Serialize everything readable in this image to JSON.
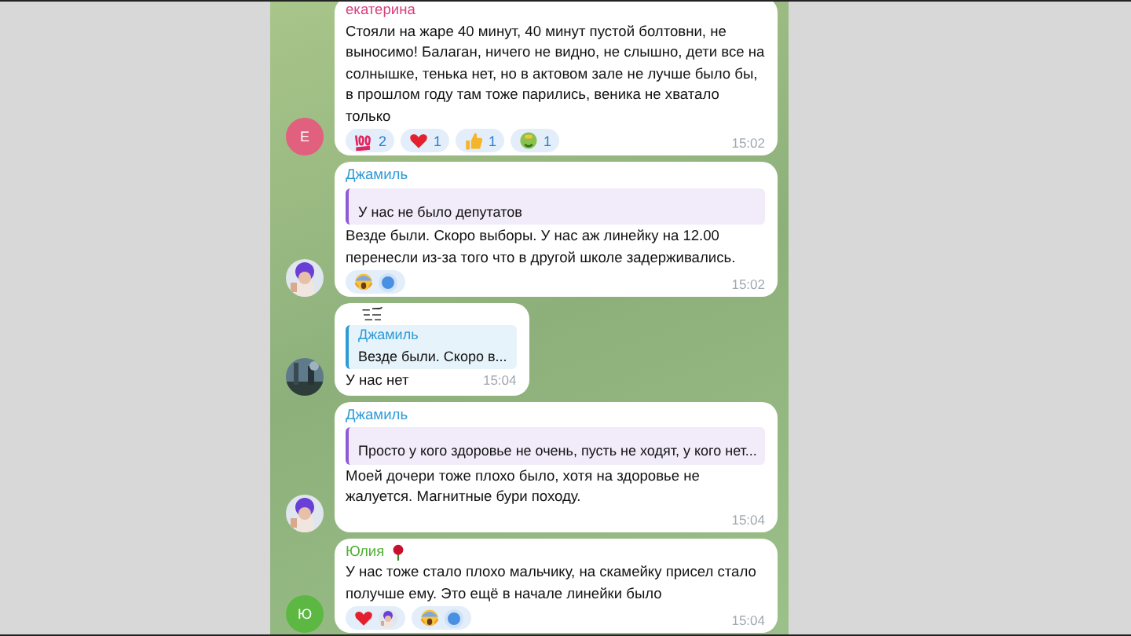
{
  "messages": [
    {
      "sender": "екатерина",
      "color": "#d63f7c",
      "avatar": {
        "kind": "letter",
        "letter": "Е",
        "color": "#e0607e"
      },
      "text": "Стояли на жаре 40 минут, 40 минут пустой болтовни, не выносимо! Балаган, ничего не видно, не слышно, дети все на солнышке, тенька нет, но в актовом зале не лучше было бы, в прошлом году там тоже парились, веника не хватало только",
      "reactions": [
        {
          "kind": "hundred",
          "count": "2"
        },
        {
          "kind": "heart",
          "count": "1"
        },
        {
          "kind": "thumbs-up",
          "count": "1"
        },
        {
          "kind": "sick",
          "count": "1"
        }
      ],
      "time": "15:02"
    },
    {
      "sender": "Джамиль",
      "color": "#2e9ad6",
      "avatar": {
        "kind": "picture"
      },
      "quote": {
        "text": "У нас не было депутатов",
        "color": "#8e5bd6"
      },
      "text": "Везде были. Скоро выборы. У нас аж линейку на 12.00 перенесли из-за того что в другой школе задерживались.",
      "reactions": [
        {
          "kind": "scream",
          "reactor": {
            "kind": "dot",
            "color": "#4a90e2"
          }
        }
      ],
      "time": "15:02"
    },
    {
      "sticker": true,
      "avatar": {
        "kind": "picture"
      },
      "quote": {
        "author": "Джамиль",
        "text": "Везде были. Скоро в...",
        "color": "#2e9ad6"
      },
      "text": "У нас нет",
      "time": "15:04"
    },
    {
      "sender": "Джамиль",
      "color": "#2e9ad6",
      "avatar": {
        "kind": "picture"
      },
      "quote": {
        "text": "Просто у кого здоровье не очень, пусть не ходят, у кого нет...",
        "color": "#8e5bd6"
      },
      "text": "Моей дочери тоже плохо было, хотя на здоровье не жалуется. Магнитные бури походу.",
      "time": "15:04"
    },
    {
      "sender": "Юлия",
      "sender_badge": true,
      "color": "#4fae33",
      "avatar": {
        "kind": "letter",
        "letter": "Ю",
        "color": "#5cb842"
      },
      "text": "У нас тоже стало плохо мальчику, на скамейку присел стало получше ему. Это ещё в начале линейки было",
      "reactions": [
        {
          "kind": "heart",
          "reactor": {
            "kind": "picture"
          }
        },
        {
          "kind": "scream",
          "reactor": {
            "kind": "dot",
            "color": "#4a90e2"
          }
        }
      ],
      "time": "15:04"
    }
  ]
}
